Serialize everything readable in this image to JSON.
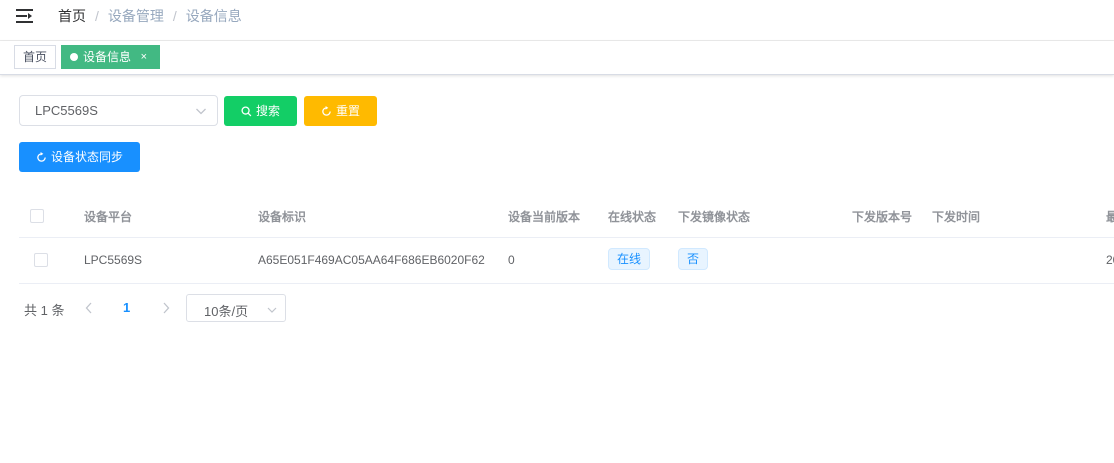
{
  "breadcrumb": [
    "首页",
    "设备管理",
    "设备信息"
  ],
  "breadcrumb_separator": "/",
  "tags": {
    "home": "首页",
    "active": "设备信息",
    "close_glyph": "×"
  },
  "form": {
    "platform_value": "LPC5569S",
    "search_label": "搜索",
    "reset_label": "重置",
    "sync_label": "设备状态同步"
  },
  "table": {
    "headers": [
      "设备平台",
      "设备标识",
      "设备当前版本",
      "在线状态",
      "下发镜像状态",
      "下发版本号",
      "下发时间",
      "最"
    ],
    "rows": [
      {
        "platform": "LPC5569S",
        "device_id": "A65E051F469AC05AA64F686EB6020F62",
        "current_version": "0",
        "online_status": "在线",
        "image_status": "否",
        "issued_version": "",
        "issued_time": "",
        "last": "20"
      }
    ]
  },
  "pagination": {
    "total": "共 1 条",
    "current_page": "1",
    "page_size": "10条/页"
  },
  "colors": {
    "search": "#13ce66",
    "reset": "#ffba00",
    "sync": "#1890ff",
    "active_tag": "#42b983"
  }
}
